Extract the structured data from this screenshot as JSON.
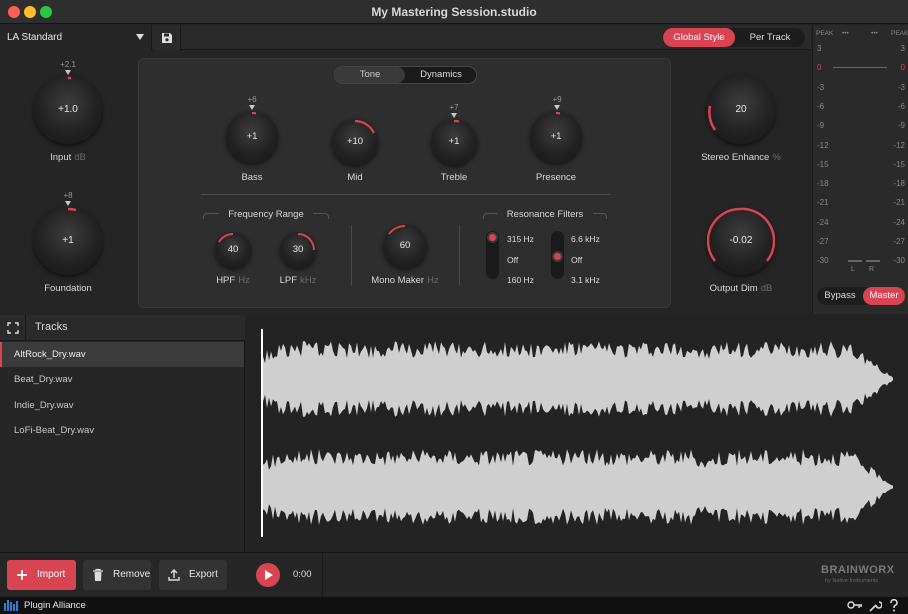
{
  "window": {
    "title": "My Mastering Session.studio"
  },
  "preset": {
    "name": "LA Standard"
  },
  "mode": {
    "active": "Global Style",
    "inactive": "Per Track"
  },
  "tabs": {
    "tone": "Tone",
    "dynamics": "Dynamics"
  },
  "knobs": {
    "input": {
      "label": "Input",
      "unit": "dB",
      "value": "+1.0",
      "top": "+2.1"
    },
    "foundation": {
      "label": "Foundation",
      "value": "+1",
      "top": "+8"
    },
    "bass": {
      "label": "Bass",
      "value": "+1",
      "top": "+6"
    },
    "mid": {
      "label": "Mid",
      "value": "+10"
    },
    "treble": {
      "label": "Treble",
      "value": "+1",
      "top": "+7"
    },
    "presence": {
      "label": "Presence",
      "value": "+1",
      "top": "+9"
    },
    "hpf": {
      "label": "HPF",
      "unit": "Hz",
      "value": "40"
    },
    "lpf": {
      "label": "LPF",
      "unit": "kHz",
      "value": "30"
    },
    "mono": {
      "label": "Mono Maker",
      "unit": "Hz",
      "value": "60"
    },
    "stereo": {
      "label": "Stereo Enhance",
      "unit": "%",
      "value": "20"
    },
    "output": {
      "label": "Output Dim",
      "unit": "dB",
      "value": "-0.02"
    }
  },
  "groups": {
    "freq_range": "Frequency Range",
    "resonance": "Resonance Filters"
  },
  "resonance": {
    "left": {
      "top": "315 Hz",
      "mid": "Off",
      "bottom": "160 Hz"
    },
    "right": {
      "top": "6.6 kHz",
      "mid": "Off",
      "bottom": "3.1 kHz"
    }
  },
  "meter": {
    "peak": "PEAK",
    "dots": "•••",
    "ticks": [
      "3",
      "0",
      "-3",
      "-6",
      "-9",
      "-12",
      "-15",
      "-18",
      "-21",
      "-24",
      "-27",
      "-30"
    ],
    "left": "L",
    "right": "R",
    "bypass": "Bypass",
    "master": "Master"
  },
  "tracks": {
    "title": "Tracks",
    "items": [
      "AltRock_Dry.wav",
      "Beat_Dry.wav",
      "Indie_Dry.wav",
      "LoFi-Beat_Dry.wav"
    ]
  },
  "controls": {
    "import": "Import",
    "remove": "Remove",
    "export": "Export",
    "time": "0:00"
  },
  "brand": {
    "name": "BRAINWORX",
    "sub": "by Native Instruments"
  },
  "footer": {
    "label": "Plugin Alliance"
  },
  "colors": {
    "accent": "#d84451"
  }
}
